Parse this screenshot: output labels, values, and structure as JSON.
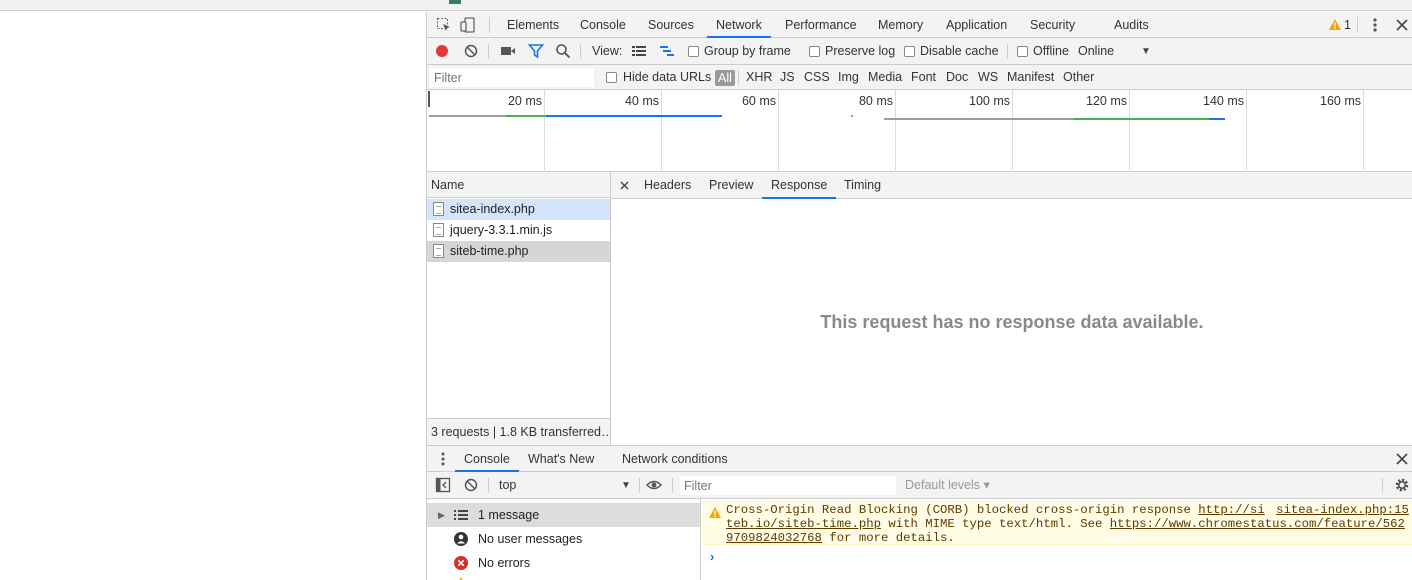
{
  "main_tabs": [
    "Elements",
    "Console",
    "Sources",
    "Network",
    "Performance",
    "Memory",
    "Application",
    "Security",
    "Audits"
  ],
  "active_tab": "Network",
  "warning_count": "1",
  "toolbar": {
    "view_label": "View:",
    "group_by_frame": "Group by frame",
    "preserve_log": "Preserve log",
    "disable_cache": "Disable cache",
    "offline": "Offline",
    "throttle_value": "Online"
  },
  "filter": {
    "placeholder": "Filter",
    "hide_data_urls": "Hide data URLs",
    "types": [
      "All",
      "XHR",
      "JS",
      "CSS",
      "Img",
      "Media",
      "Font",
      "Doc",
      "WS",
      "Manifest",
      "Other"
    ]
  },
  "timeline": {
    "ticks": [
      "20 ms",
      "40 ms",
      "60 ms",
      "80 ms",
      "100 ms",
      "120 ms",
      "140 ms",
      "160 ms"
    ]
  },
  "requests": {
    "header": "Name",
    "items": [
      "sitea-index.php",
      "jquery-3.3.1.min.js",
      "siteb-time.php"
    ],
    "summary": "3 requests | 1.8 KB transferred…"
  },
  "detail": {
    "tabs": [
      "Headers",
      "Preview",
      "Response",
      "Timing"
    ],
    "active": "Response",
    "message": "This request has no response data available."
  },
  "drawer": {
    "tabs": [
      "Console",
      "What's New",
      "Network conditions"
    ],
    "context": "top",
    "filter_placeholder": "Filter",
    "levels": "Default levels ▾",
    "sidebar": [
      "1 message",
      "No user messages",
      "No errors"
    ],
    "warning": {
      "text1": "Cross-Origin Read Blocking (CORB) blocked cross-origin response ",
      "url1a": "http://si",
      "source": "sitea-index.php:15",
      "url1b": "teb.io/siteb-time.php",
      "text2": " with MIME type text/html. See ",
      "url2a": "https://www.chromestatus.com/feature/562",
      "url2b": "9709824032768",
      "text3": " for more details."
    }
  },
  "colors": {
    "accent": "#1a73e8",
    "record": "#e53935",
    "warning_bg": "#fffbe5",
    "error": "#d93025"
  }
}
